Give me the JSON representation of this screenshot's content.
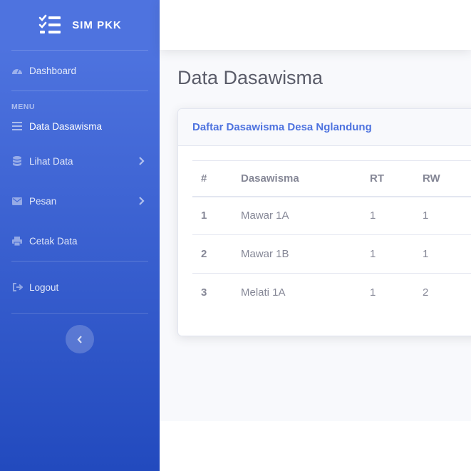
{
  "brand": {
    "name": "SIM PKK"
  },
  "sidebar": {
    "dashboard": "Dashboard",
    "menu_heading": "MENU",
    "items": [
      {
        "label": "Data Dasawisma",
        "icon": "list-icon",
        "has_arrow": false
      },
      {
        "label": "Lihat Data",
        "icon": "database-icon",
        "has_arrow": true
      },
      {
        "label": "Pesan",
        "icon": "envelope-icon",
        "has_arrow": true
      },
      {
        "label": "Cetak Data",
        "icon": "print-icon",
        "has_arrow": false
      }
    ],
    "logout": "Logout"
  },
  "main": {
    "page_title": "Data Dasawisma",
    "card_title": "Daftar Dasawisma Desa Nglandung",
    "table": {
      "headers": [
        "#",
        "Dasawisma",
        "RT",
        "RW"
      ],
      "rows": [
        [
          "1",
          "Mawar 1A",
          "1",
          "1"
        ],
        [
          "2",
          "Mawar 1B",
          "1",
          "1"
        ],
        [
          "3",
          "Melati 1A",
          "1",
          "2"
        ]
      ]
    }
  },
  "colors": {
    "sidebar_start": "#4e73df",
    "sidebar_end": "#224abe",
    "accent": "#4e73df",
    "text_muted": "#858796"
  }
}
